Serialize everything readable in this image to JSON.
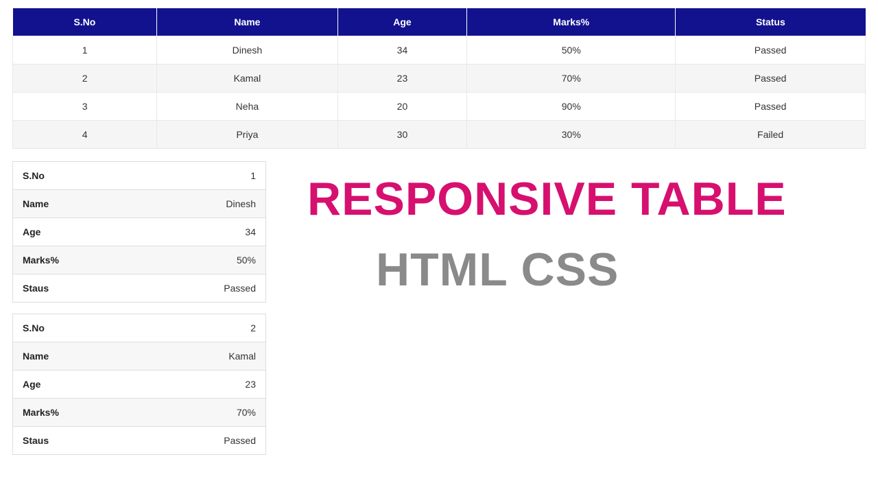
{
  "table": {
    "headers": [
      "S.No",
      "Name",
      "Age",
      "Marks%",
      "Status"
    ],
    "rows": [
      {
        "sno": "1",
        "name": "Dinesh",
        "age": "34",
        "marks": "50%",
        "status": "Passed"
      },
      {
        "sno": "2",
        "name": "Kamal",
        "age": "23",
        "marks": "70%",
        "status": "Passed"
      },
      {
        "sno": "3",
        "name": "Neha",
        "age": "20",
        "marks": "90%",
        "status": "Passed"
      },
      {
        "sno": "4",
        "name": "Priya",
        "age": "30",
        "marks": "30%",
        "status": "Failed"
      }
    ]
  },
  "cards": {
    "labels": {
      "sno": "S.No",
      "name": "Name",
      "age": "Age",
      "marks": "Marks%",
      "status": "Staus"
    },
    "items": [
      {
        "sno": "1",
        "name": "Dinesh",
        "age": "34",
        "marks": "50%",
        "status": "Passed"
      },
      {
        "sno": "2",
        "name": "Kamal",
        "age": "23",
        "marks": "70%",
        "status": "Passed"
      }
    ]
  },
  "titles": {
    "line1": "RESPONSIVE TABLE",
    "line2": "HTML CSS"
  }
}
